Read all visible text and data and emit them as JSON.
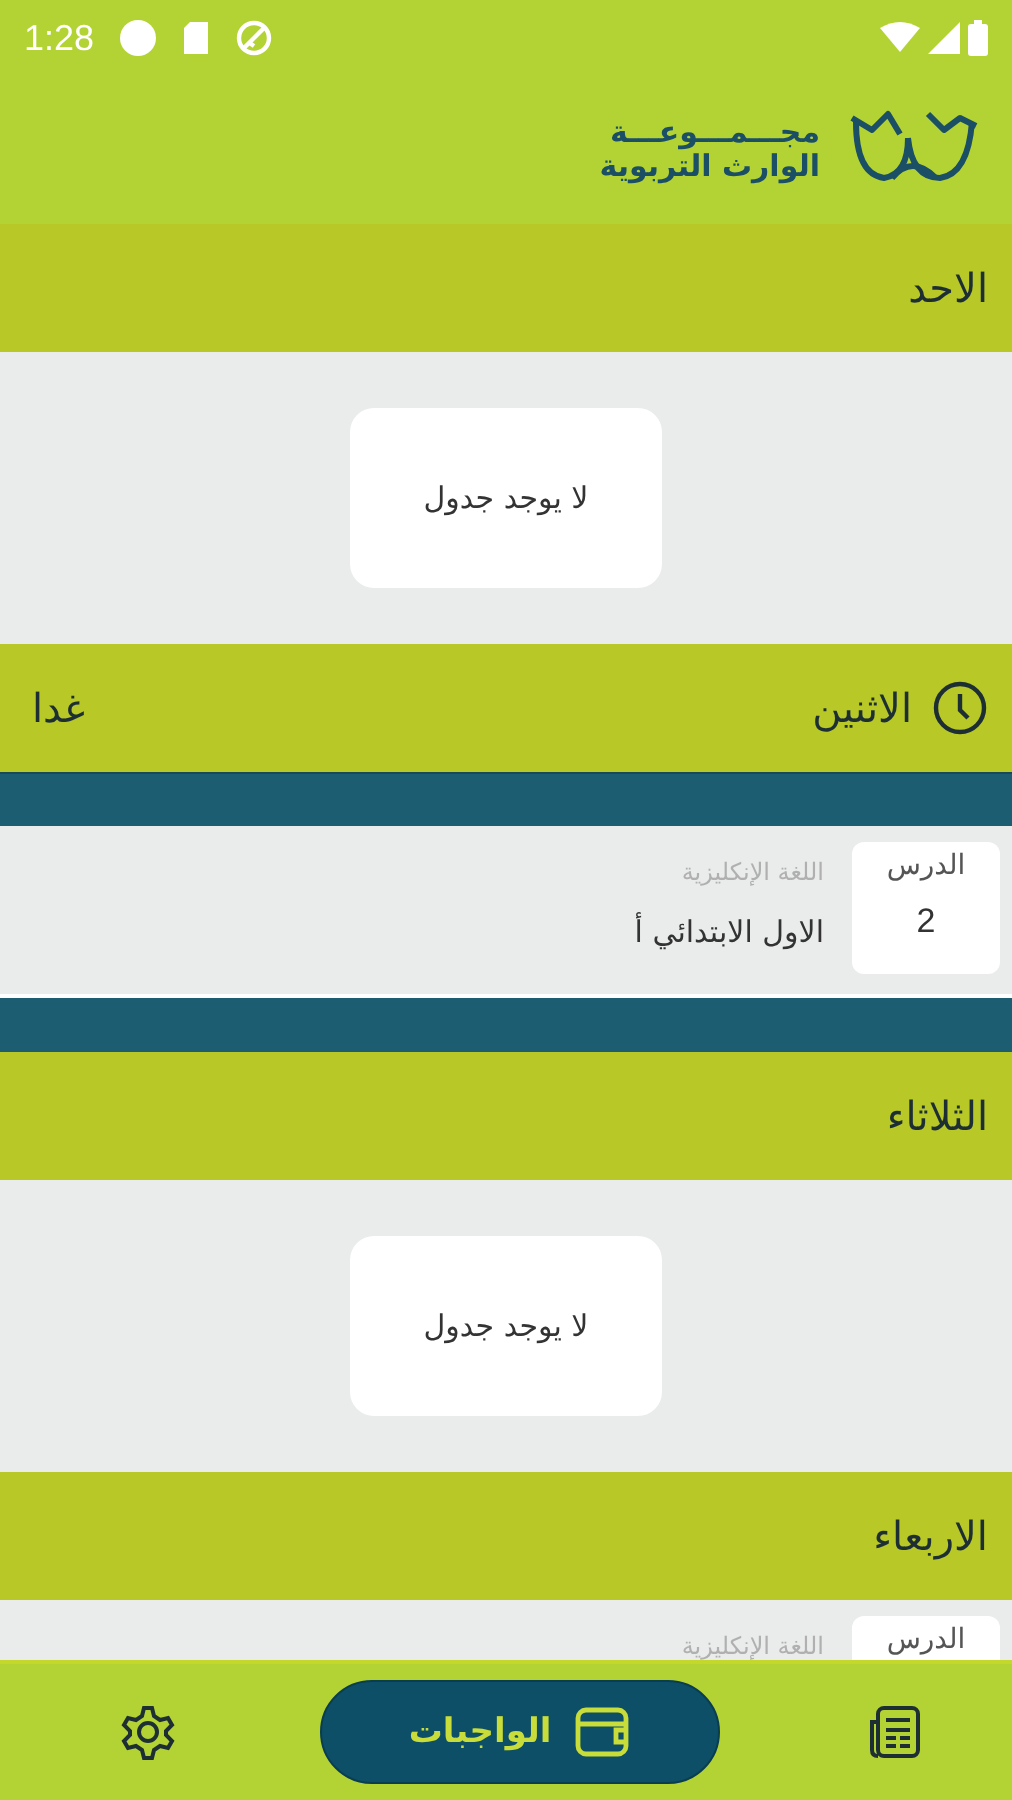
{
  "status_bar": {
    "time": "1:28"
  },
  "header": {
    "logo_line_1": "مجـــمـــوعـــة",
    "logo_line_2": "الوارث التربوية"
  },
  "days": [
    {
      "name": "الاحد",
      "highlighted": false,
      "empty_message": "لا يوجد جدول"
    },
    {
      "name": "الاثنين",
      "highlighted": true,
      "note": "غدا",
      "lessons": [
        {
          "period_label": "الدرس",
          "period": "2",
          "subject": "اللغة الإنكليزية",
          "class_name": "الاول الابتدائي أ"
        }
      ]
    },
    {
      "name": "الثلاثاء",
      "highlighted": false,
      "empty_message": "لا يوجد جدول"
    },
    {
      "name": "الاربعاء",
      "highlighted": false,
      "lessons": [
        {
          "period_label": "الدرس",
          "subject": "اللغة الإنكليزية"
        }
      ]
    }
  ],
  "bottom_nav": [
    {
      "kind": "schedule",
      "selected": false
    },
    {
      "kind": "homework",
      "label": "الواجبات",
      "selected": true
    },
    {
      "kind": "settings",
      "selected": false
    }
  ]
}
